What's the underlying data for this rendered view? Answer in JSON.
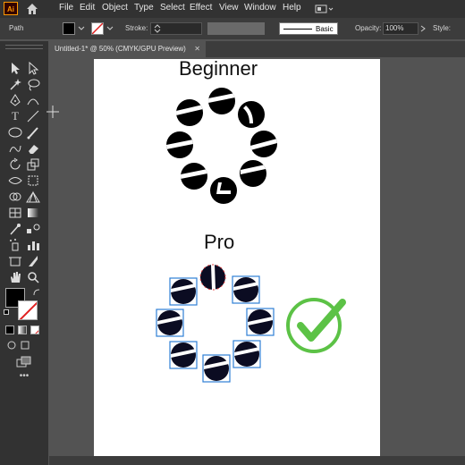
{
  "app": {
    "logo_text": "Ai",
    "menu": [
      "File",
      "Edit",
      "Object",
      "Type",
      "Select",
      "Effect",
      "View",
      "Window",
      "Help"
    ]
  },
  "control_bar": {
    "selection_label": "Path",
    "stroke_label": "Stroke:",
    "brush_label": "Basic",
    "opacity_label": "Opacity:",
    "opacity_value": "100%",
    "style_label": "Style:"
  },
  "document_tab": {
    "title": "Untitled-1* @ 50% (CMYK/GPU Preview)"
  },
  "artboard": {
    "title_top": "Beginner",
    "title_bottom": "Pro"
  },
  "colors": {
    "check_green": "#5cc246",
    "selection_blue": "#2e7fd6",
    "selection_red": "#e23b3b",
    "logo_orange": "#ff9a00"
  },
  "icons": {
    "home": "home-icon",
    "check": "checkmark-icon"
  }
}
